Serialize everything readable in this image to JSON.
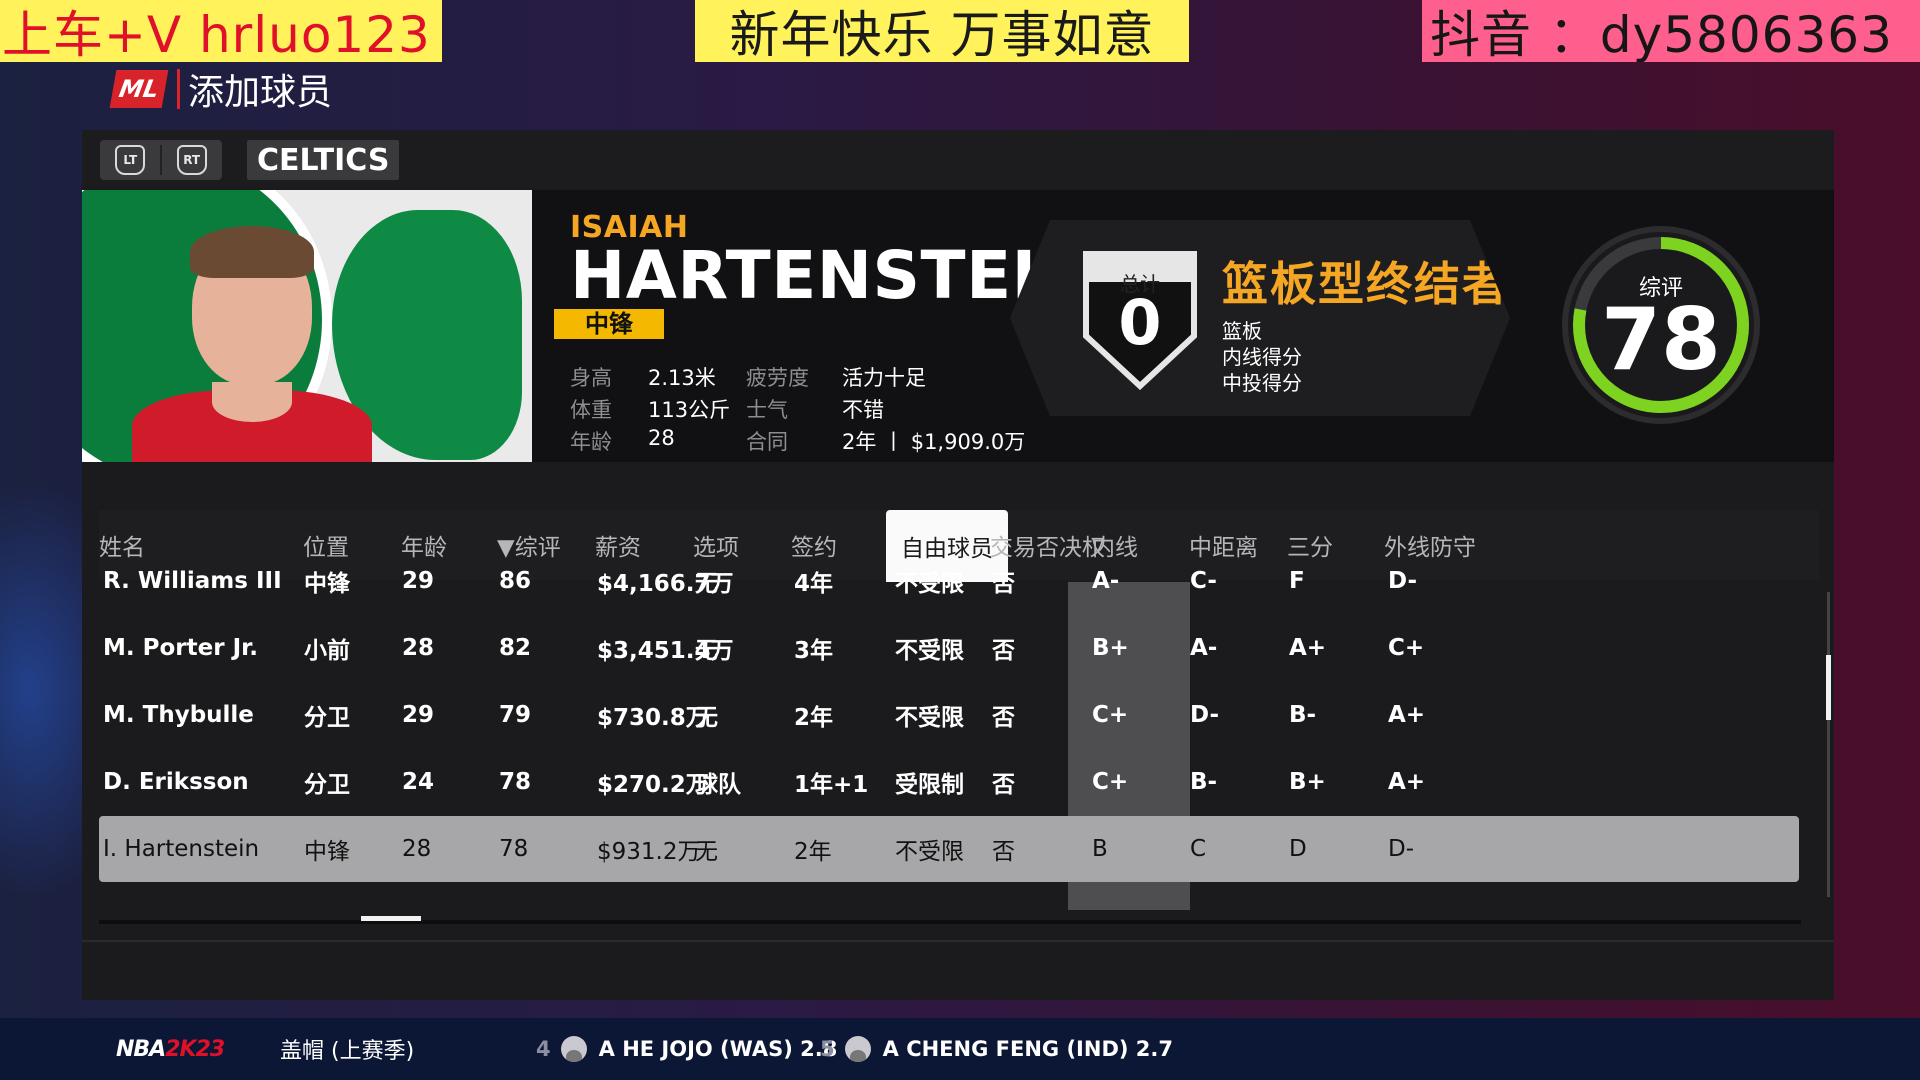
{
  "overlay": {
    "left": "上车+V  hrluo123",
    "middle": "新年快乐 万事如意",
    "right": "抖音 ：dy5806363"
  },
  "header": {
    "logo_text": "ML",
    "title": "添加球员"
  },
  "team_bar": {
    "lt_label": "LT",
    "rt_label": "RT",
    "team": "CELTICS"
  },
  "player": {
    "first_name": "ISAIAH",
    "last_name": "HARTENSTEIN",
    "position": "中锋",
    "stats": [
      {
        "label": "身高",
        "value": "2.13米",
        "label2": "疲劳度",
        "value2": "活力十足"
      },
      {
        "label": "体重",
        "value": "113公斤",
        "label2": "士气",
        "value2": "不错"
      },
      {
        "label": "年龄",
        "value": "28",
        "label2": "合同",
        "value2": "2年 丨 $1,909.0万"
      }
    ],
    "badges_label": "总计",
    "badges_count": "0",
    "archetype": "篮板型终结者",
    "skills": [
      "篮板",
      "内线得分",
      "中投得分"
    ],
    "rating_label": "综评",
    "rating": "78",
    "rating_fraction": 0.78,
    "rating_color": "#7ed321"
  },
  "table": {
    "columns": [
      "姓名",
      "位置",
      "年龄",
      "▼综评",
      "薪资",
      "选项",
      "签约",
      "自由球员",
      "交易否决权",
      "内线",
      "中距离",
      "三分",
      "外线防守"
    ],
    "active_column": "自由球员",
    "rows": [
      [
        "R. Williams III",
        "中锋",
        "29",
        "86",
        "$4,166.7万",
        "无",
        "4年",
        "不受限",
        "否",
        "A-",
        "C-",
        "F",
        "D-"
      ],
      [
        "M. Porter Jr.",
        "小前",
        "28",
        "82",
        "$3,451.4万",
        "无",
        "3年",
        "不受限",
        "否",
        "B+",
        "A-",
        "A+",
        "C+"
      ],
      [
        "M. Thybulle",
        "分卫",
        "29",
        "79",
        "$730.8万",
        "无",
        "2年",
        "不受限",
        "否",
        "C+",
        "D-",
        "B-",
        "A+"
      ],
      [
        "D. Eriksson",
        "分卫",
        "24",
        "78",
        "$270.2万",
        "球队",
        "1年+1",
        "受限制",
        "否",
        "C+",
        "B-",
        "B+",
        "A+"
      ],
      [
        "I. Hartenstein",
        "中锋",
        "28",
        "78",
        "$931.2万",
        "无",
        "2年",
        "不受限",
        "否",
        "B",
        "C",
        "D",
        "D-"
      ]
    ],
    "selected_row": 4
  },
  "ticker": {
    "logo_main": "NBA",
    "logo_sub": "2K23",
    "category": "盖帽 (上赛季)",
    "items": [
      {
        "rank": "4",
        "text": "A HE JOJO (WAS) 2.8"
      },
      {
        "rank": "5",
        "text": "A CHENG FENG (IND) 2.7"
      }
    ]
  },
  "colors": {
    "accent_orange": "#f5a623",
    "position_yellow": "#f5b800",
    "rating_green": "#7ed321",
    "ml_red": "#d8232a"
  }
}
